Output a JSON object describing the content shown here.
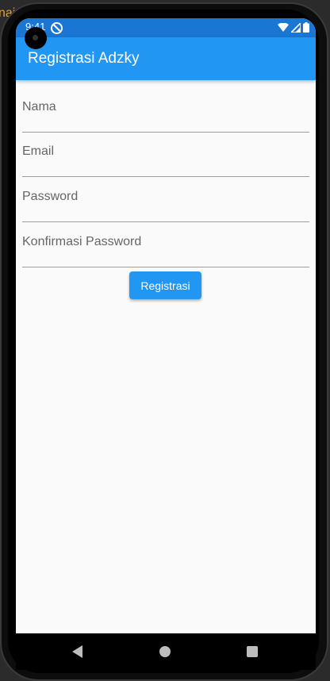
{
  "background_label": "nai",
  "status_bar": {
    "time": "9:41"
  },
  "app_bar": {
    "title": "Registrasi Adzky",
    "color": "#2196f3"
  },
  "form": {
    "fields": [
      {
        "label": "Nama"
      },
      {
        "label": "Email"
      },
      {
        "label": "Password"
      },
      {
        "label": "Konfirmasi Password"
      }
    ],
    "submit_label": "Registrasi"
  },
  "nav": {
    "back_icon": "back-triangle",
    "home_icon": "home-circle",
    "recent_icon": "recent-square"
  }
}
